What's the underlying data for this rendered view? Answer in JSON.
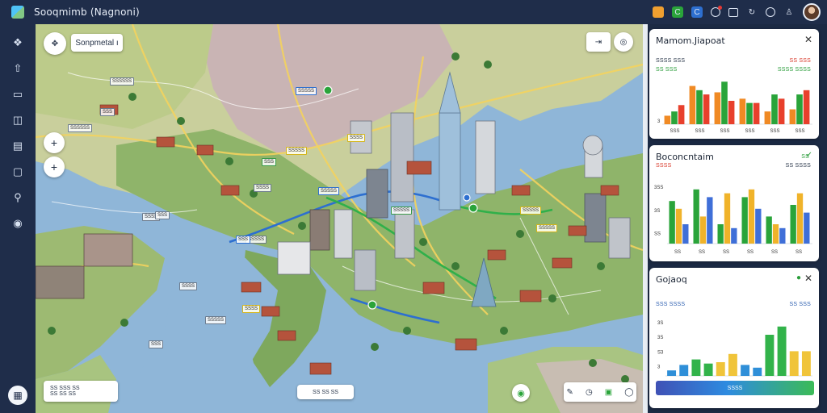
{
  "app": {
    "title": "Sooqmimb (Nagnoni)"
  },
  "top_icons": [
    "color-palette-icon",
    "green-app-icon",
    "blue-app-icon",
    "notification-icon",
    "message-icon",
    "refresh-icon",
    "globe-icon",
    "user-icon"
  ],
  "rail_icons": [
    "network-icon",
    "upload-icon",
    "window-icon",
    "book-icon",
    "frame-icon",
    "clipboard-icon",
    "search-icon",
    "globe-icon"
  ],
  "map": {
    "search_label": "Sonpmetal ı",
    "legend_text": "SS SSS SS",
    "legend_subtext": "SS SS SS",
    "bottom_chip_text": "SS SS SS",
    "labels": [
      {
        "t": "SSSSSS",
        "c": ""
      },
      {
        "t": "SSS",
        "c": ""
      },
      {
        "t": "SSSSS",
        "c": "b"
      },
      {
        "t": "SSSSSS",
        "c": ""
      },
      {
        "t": "SSSS",
        "c": "y"
      },
      {
        "t": "SSSSS",
        "c": "y"
      },
      {
        "t": "SSS",
        "c": "g"
      },
      {
        "t": "SSSS",
        "c": ""
      },
      {
        "t": "SSSSS",
        "c": "g"
      },
      {
        "t": "SSSSS",
        "c": "b"
      },
      {
        "t": "SSSSS",
        "c": "y"
      },
      {
        "t": "SSSS",
        "c": ""
      },
      {
        "t": "SSSSS",
        "c": "y"
      },
      {
        "t": "SSSSS",
        "c": ""
      },
      {
        "t": "SSS",
        "c": ""
      },
      {
        "t": "SSSS",
        "c": "y"
      },
      {
        "t": "SSSS",
        "c": ""
      },
      {
        "t": "SSSSS",
        "c": ""
      },
      {
        "t": "SSS",
        "c": ""
      },
      {
        "t": "SSS",
        "c": "b"
      }
    ]
  },
  "panels": [
    {
      "title": "Mamom.Jiapoat",
      "kpis": [
        {
          "t": "SSSS SSS",
          "c": "dark"
        },
        {
          "t": "SS SSS",
          "c": "green"
        },
        {
          "t": "SSSS SSSS",
          "c": "green"
        },
        {
          "t": "SS SSS",
          "c": "red"
        }
      ],
      "chart_data": {
        "type": "bar",
        "yticks": [
          "3"
        ],
        "categories": [
          "SSS",
          "SSS",
          "SSS",
          "SSS",
          "SSS",
          "SSS"
        ],
        "series": [
          {
            "values": [
              4,
              18,
              15,
              12,
              6,
              7
            ]
          },
          {
            "values": [
              6,
              16,
              20,
              10,
              14,
              14
            ]
          },
          {
            "values": [
              9,
              14,
              11,
              10,
              12,
              16
            ]
          }
        ],
        "ylim": [
          0,
          22
        ],
        "colors": [
          "#f08a24",
          "#2aa43a",
          "#e8402c"
        ]
      }
    },
    {
      "title": "Boconcntaim",
      "kpis": [
        {
          "t": "SSSS",
          "c": "red"
        },
        {
          "t": "SS",
          "c": "green"
        },
        {
          "t": "SS SSSS",
          "c": "dark"
        }
      ],
      "chart_data": {
        "type": "bar",
        "yticks": [
          "3SS",
          "3S",
          "SS"
        ],
        "categories": [
          "SS",
          "SS",
          "SS",
          "SS",
          "SS",
          "SS"
        ],
        "series": [
          {
            "values": [
              22,
              28,
              10,
              24,
              14,
              20
            ]
          },
          {
            "values": [
              18,
              14,
              26,
              28,
              10,
              26
            ]
          },
          {
            "values": [
              10,
              24,
              8,
              18,
              8,
              16
            ]
          }
        ],
        "ylim": [
          0,
          30
        ],
        "colors": [
          "#2aa43a",
          "#f0b32a",
          "#3f6fd8"
        ]
      }
    },
    {
      "title": "Gojaoq",
      "kpis": [
        {
          "t": "SSS SSSS",
          "c": "blue"
        },
        {
          "t": "SS SSS",
          "c": "blue"
        }
      ],
      "chart_data": {
        "type": "bar",
        "yticks": [
          "3S",
          "3S",
          "S3",
          "3"
        ],
        "categories": [],
        "series": [
          {
            "values": [
              4,
              8,
              12,
              9,
              10,
              16,
              8,
              6,
              30,
              36,
              18,
              18
            ]
          }
        ],
        "ylim": [
          0,
          40
        ],
        "colors": [
          "#2f8fd8",
          "#32b34a",
          "#f0c43a"
        ]
      },
      "button_text": "SSSS"
    }
  ]
}
